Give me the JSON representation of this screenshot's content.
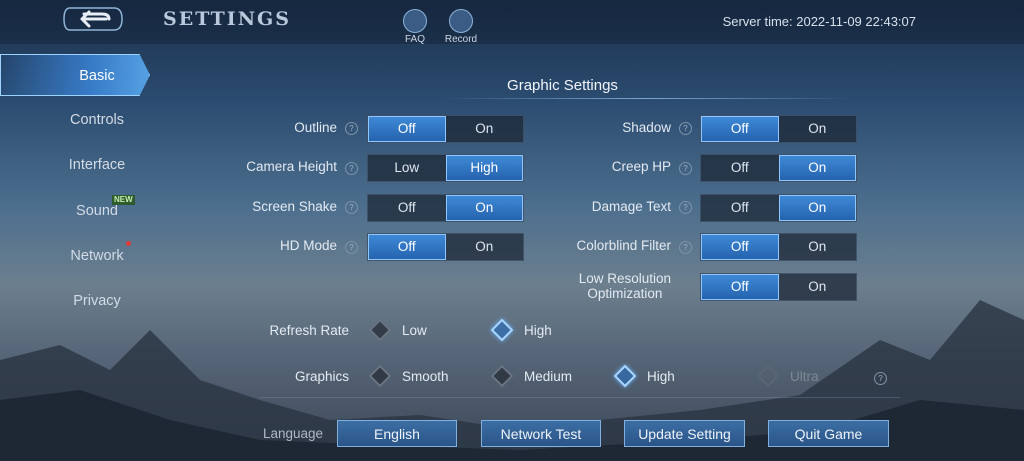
{
  "header": {
    "title": "SETTINGS",
    "faq_label": "FAQ",
    "record_label": "Record",
    "server_time": "Server time: 2022-11-09 22:43:07"
  },
  "sidebar": {
    "items": [
      {
        "label": "Basic",
        "active": true
      },
      {
        "label": "Controls"
      },
      {
        "label": "Interface"
      },
      {
        "label": "Sound",
        "badge": "NEW"
      },
      {
        "label": "Network",
        "red_dot": true
      },
      {
        "label": "Privacy"
      }
    ]
  },
  "graphic": {
    "title": "Graphic Settings",
    "help_glyph": "?",
    "left": [
      {
        "label": "Outline",
        "opt1": "Off",
        "opt2": "On",
        "selected": "Off"
      },
      {
        "label": "Camera Height",
        "opt1": "Low",
        "opt2": "High",
        "selected": "High"
      },
      {
        "label": "Screen Shake",
        "opt1": "Off",
        "opt2": "On",
        "selected": "On"
      },
      {
        "label": "HD Mode",
        "opt1": "Off",
        "opt2": "On",
        "selected": "Off"
      }
    ],
    "right": [
      {
        "label": "Shadow",
        "opt1": "Off",
        "opt2": "On",
        "selected": "Off"
      },
      {
        "label": "Creep HP",
        "opt1": "Off",
        "opt2": "On",
        "selected": "On"
      },
      {
        "label": "Damage Text",
        "opt1": "Off",
        "opt2": "On",
        "selected": "On"
      },
      {
        "label": "Colorblind Filter",
        "opt1": "Off",
        "opt2": "On",
        "selected": "Off"
      },
      {
        "label_line1": "Low Resolution",
        "label_line2": "Optimization",
        "opt1": "Off",
        "opt2": "On",
        "selected": "Off"
      }
    ],
    "refresh_rate": {
      "label": "Refresh Rate",
      "options": [
        "Low",
        "High"
      ],
      "selected": "High"
    },
    "graphics": {
      "label": "Graphics",
      "options": [
        "Smooth",
        "Medium",
        "High",
        "Ultra"
      ],
      "selected": "High",
      "disabled": [
        "Ultra"
      ]
    }
  },
  "footer": {
    "language_label": "Language",
    "buttons": [
      "English",
      "Network Test",
      "Update Setting",
      "Quit Game"
    ]
  },
  "colors": {
    "accent": "#3f8ad8",
    "selected_border": "#8fc6ff",
    "badge_dot": "#e03a3a"
  }
}
